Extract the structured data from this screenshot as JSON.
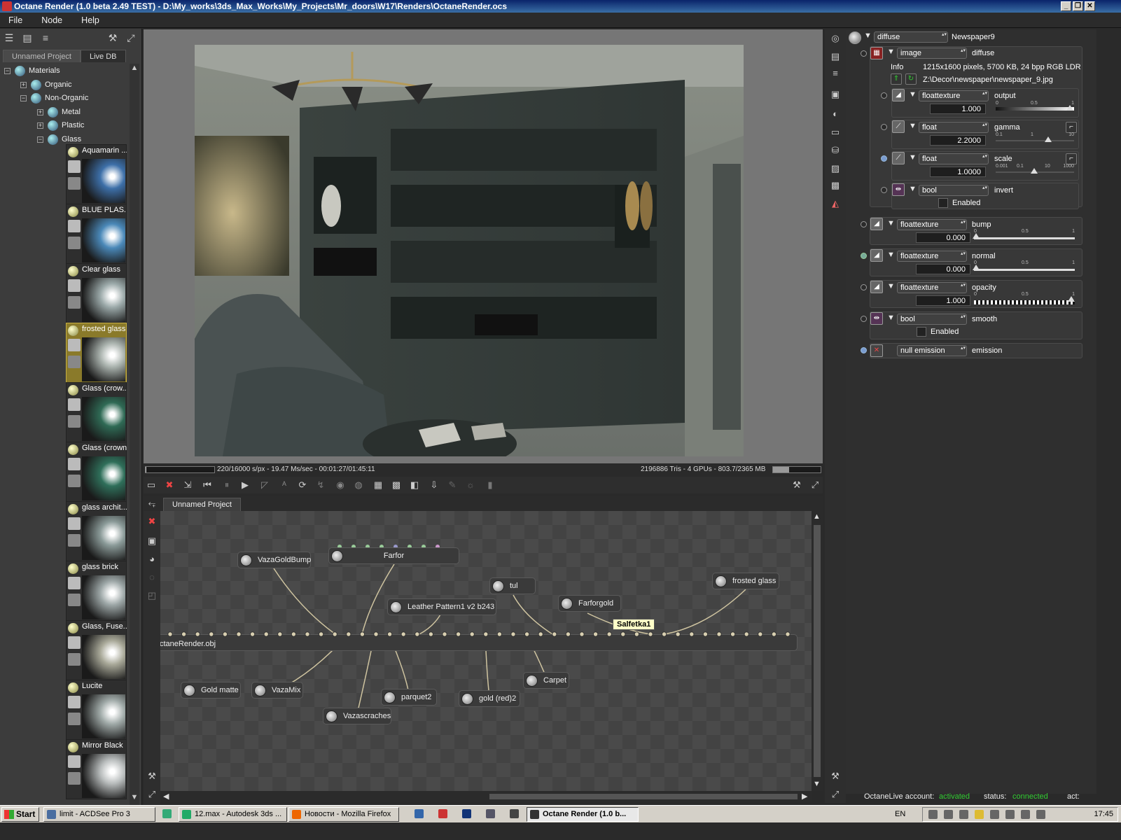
{
  "window": {
    "title": "Octane Render (1.0 beta 2.49 TEST) - D:\\My_works\\3ds_Max_Works\\My_Projects\\Mr_doors\\W17\\Renders\\OctaneRender.ocs",
    "min": "_",
    "max": "❐",
    "close": "✕"
  },
  "menu": [
    "File",
    "Node",
    "Help"
  ],
  "left": {
    "tabs": [
      "Unnamed Project",
      "Live DB"
    ],
    "tree": [
      {
        "label": "Materials",
        "toggle": "−"
      },
      {
        "label": "Organic",
        "toggle": "+"
      },
      {
        "label": "Non-Organic",
        "toggle": "−"
      },
      {
        "label": "Metal",
        "toggle": "+"
      },
      {
        "label": "Plastic",
        "toggle": "+"
      },
      {
        "label": "Glass",
        "toggle": "−"
      }
    ],
    "materials": [
      {
        "name": "Aquamarin ...",
        "color": "#3d6fa8"
      },
      {
        "name": "BLUE PLAS...",
        "color": "#4a88b8"
      },
      {
        "name": "Clear glass",
        "color": "#9aa8a8"
      },
      {
        "name": "frosted glass",
        "color": "#a9b2ad"
      },
      {
        "name": "Glass (crow...",
        "color": "#2f6a55"
      },
      {
        "name": "Glass (crown)",
        "color": "#2f6f5a"
      },
      {
        "name": "glass archit...",
        "color": "#8a9a98"
      },
      {
        "name": "glass brick",
        "color": "#9ca6a6"
      },
      {
        "name": "Glass, Fuse...",
        "color": "#a8a898"
      },
      {
        "name": "Lucite",
        "color": "#a0aaa8"
      },
      {
        "name": "Mirror Black",
        "color": "#b8bcbc"
      }
    ]
  },
  "status": {
    "left": "220/16000 s/px - 19.47 Ms/sec - 00:01:27/01:45:11",
    "right": "2196886 Tris - 4 GPUs - 803.7/2365 MB",
    "progress": 0.0138,
    "memory": 0.34
  },
  "node_editor": {
    "tab": "Unnamed Project",
    "nodes": {
      "vazagoldbump": "VazaGoldBump",
      "farfor": "Farfor",
      "tul": "tul",
      "frosted_glass": "frosted glass",
      "leather": "Leather Pattern1 v2 b243",
      "farforgold": "Farforgold",
      "mesh": "ctaneRender.obj",
      "gold_matte": "Gold matte",
      "vazamix": "VazaMix",
      "parquet2": "parquet2",
      "gold_red2": "gold (red)2",
      "carpet": "Carpet",
      "vazascraches": "Vazascraches"
    },
    "tooltip": "Salfetka1"
  },
  "inspector": {
    "root": {
      "type": "diffuse",
      "name": "Newspaper9"
    },
    "image": {
      "type": "image",
      "name": "diffuse",
      "info_label": "Info",
      "info": "1215x1600 pixels, 5700 KB, 24 bpp RGB LDR",
      "path": "Z:\\Decor\\newspaper\\newspaper_9.jpg"
    },
    "output": {
      "type": "floattexture",
      "name": "output",
      "value": "1.000",
      "ticks": [
        "0",
        "0.5",
        "1"
      ]
    },
    "gamma": {
      "type": "float",
      "name": "gamma",
      "value": "2.2000",
      "ticks": [
        "0.1",
        "1",
        "10"
      ]
    },
    "scale": {
      "type": "float",
      "name": "scale",
      "value": "1.0000",
      "ticks": [
        "0.001",
        "0.1",
        "10",
        "1000"
      ]
    },
    "invert": {
      "type": "bool",
      "name": "invert",
      "check": "Enabled"
    },
    "bump": {
      "type": "floattexture",
      "name": "bump",
      "value": "0.000",
      "ticks": [
        "0",
        "0.5",
        "1"
      ]
    },
    "normal": {
      "type": "floattexture",
      "name": "normal",
      "value": "0.000",
      "ticks": [
        "0",
        "0.5",
        "1"
      ]
    },
    "opacity": {
      "type": "floattexture",
      "name": "opacity",
      "value": "1.000",
      "ticks": [
        "0",
        "0.5",
        "1"
      ]
    },
    "smooth": {
      "type": "bool",
      "name": "smooth",
      "check": "Enabled"
    },
    "emission": {
      "type": "null emission",
      "name": "emission"
    }
  },
  "live": {
    "account_label": "OctaneLive account:",
    "account_value": "activated",
    "status_label": "status:",
    "status_value": "connected",
    "act_label": "act:",
    "accent": "#33cc33"
  },
  "taskbar": {
    "start": "Start",
    "buttons": [
      "limit - ACDSee Pro 3",
      "12.max - Autodesk 3ds ...",
      "Новости - Mozilla Firefox",
      "Octane Render (1.0 b..."
    ],
    "lang": "EN",
    "clock": "17:45"
  }
}
